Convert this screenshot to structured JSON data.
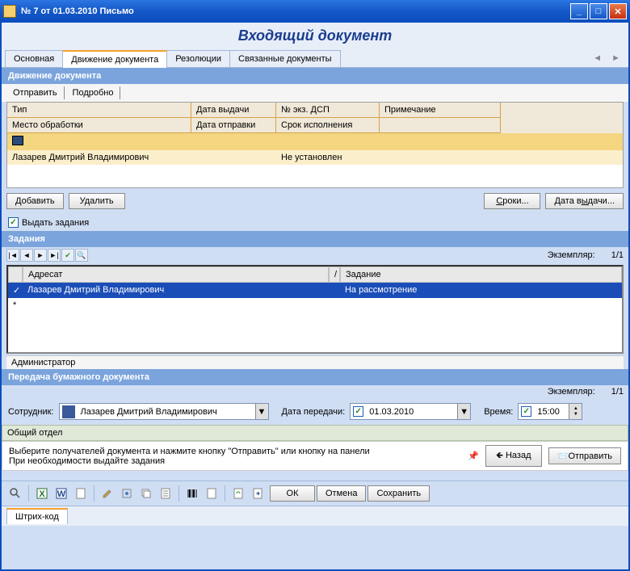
{
  "window": {
    "title": "№ 7 от 01.03.2010 Письмо"
  },
  "page": {
    "title": "Входящий документ"
  },
  "tabs": [
    "Основная",
    "Движение документа",
    "Резолюции",
    "Связанные документы"
  ],
  "section1": {
    "title": "Движение документа",
    "subtabs": [
      "Отправить",
      "Подробно"
    ],
    "grid": {
      "headers": {
        "r1": [
          "Тип",
          "Дата выдачи",
          "№ экз. ДСП",
          "Примечание"
        ],
        "r2": [
          "Место обработки",
          "Дата отправки",
          "Срок исполнения"
        ]
      },
      "rows": [
        {
          "c1": "",
          "c2": "",
          "c3": "",
          "c4": ""
        },
        {
          "c1": "Лазарев Дмитрий Владимирович",
          "c2": "",
          "c3": "Не установлен",
          "c4": ""
        }
      ]
    },
    "buttons": {
      "add": "Добавить",
      "delete": "Удалить",
      "terms": "Сроки...",
      "issue": "Дата выдачи..."
    },
    "checkbox": "Выдать задания"
  },
  "section2": {
    "title": "Задания",
    "counterLabel": "Экземпляр:",
    "counterValue": "1/1",
    "table": {
      "headers": [
        "Адресат",
        "Задание"
      ],
      "row": {
        "addressee": "Лазарев Дмитрий Владимирович",
        "task": "На рассмотрение"
      }
    },
    "status": "Администратор"
  },
  "section3": {
    "title": "Передача бумажного документа",
    "counterLabel": "Экземпляр:",
    "counterValue": "1/1",
    "employee": {
      "label": "Сотрудник:",
      "value": "Лазарев Дмитрий Владимирович"
    },
    "transferDate": {
      "label": "Дата передачи:",
      "value": "01.03.2010"
    },
    "time": {
      "label": "Время:",
      "value": "15:00"
    },
    "department": "Общий отдел"
  },
  "bottom": {
    "info": "Выберите получателей документа и нажмите кнопку \"Отправить\" или кнопку на панели\nПри необходимости выдайте задания",
    "back": "Назад",
    "send": "Отправить"
  },
  "footer": {
    "ok": "ОК",
    "cancel": "Отмена",
    "save": "Сохранить",
    "barcode": "Штрих-код"
  }
}
